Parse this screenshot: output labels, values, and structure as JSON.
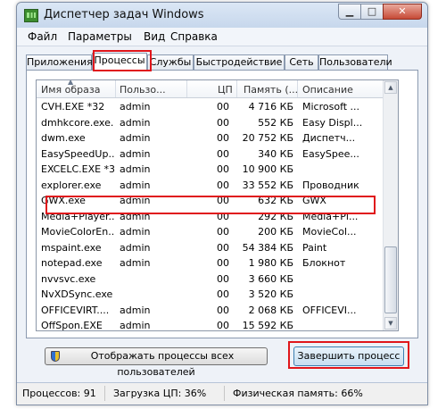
{
  "window": {
    "title": "Диспетчер задач Windows"
  },
  "menu": {
    "file": "Файл",
    "options": "Параметры",
    "view": "Вид",
    "help": "Справка"
  },
  "tabs": [
    "Приложения",
    "Процессы",
    "Службы",
    "Быстродействие",
    "Сеть",
    "Пользователи"
  ],
  "active_tab": "Процессы",
  "columns": [
    "Имя образа",
    "Пользо...",
    "ЦП",
    "Память (...",
    "Описание"
  ],
  "processes": [
    [
      "CVH.EXE *32",
      "admin",
      "00",
      "4 716 КБ",
      "Microsoft ..."
    ],
    [
      "dmhkcore.exe...",
      "admin",
      "00",
      "552 КБ",
      "Easy Displ..."
    ],
    [
      "dwm.exe",
      "admin",
      "00",
      "20 752 КБ",
      "Диспетч..."
    ],
    [
      "EasySpeedUp...",
      "admin",
      "00",
      "340 КБ",
      "EasySpee..."
    ],
    [
      "EXCELC.EXE *32",
      "admin",
      "00",
      "10 900 КБ",
      ""
    ],
    [
      "explorer.exe",
      "admin",
      "00",
      "33 552 КБ",
      "Проводник"
    ],
    [
      "GWX.exe",
      "admin",
      "00",
      "632 КБ",
      "GWX"
    ],
    [
      "Media+Player...",
      "admin",
      "00",
      "292 КБ",
      "Media+Pl..."
    ],
    [
      "MovieColorEn...",
      "admin",
      "00",
      "200 КБ",
      "MovieCol..."
    ],
    [
      "mspaint.exe",
      "admin",
      "00",
      "54 384 КБ",
      "Paint"
    ],
    [
      "notepad.exe",
      "admin",
      "00",
      "1 980 КБ",
      "Блокнот"
    ],
    [
      "nvvsvc.exe",
      "",
      "00",
      "3 660 КБ",
      ""
    ],
    [
      "NvXDSync.exe",
      "",
      "00",
      "3 520 КБ",
      ""
    ],
    [
      "OFFICEVIRT....",
      "admin",
      "00",
      "2 068 КБ",
      "OFFICEVI..."
    ],
    [
      "OffSpon.EXE",
      "admin",
      "00",
      "15 592 КБ",
      ""
    ]
  ],
  "selected_process": "GWX.exe",
  "buttons": {
    "show_all": "Отображать процессы всех пользователей",
    "end_process": "Завершить процесс"
  },
  "status": {
    "processes": "Процессов: 91",
    "cpu": "Загрузка ЦП: 36%",
    "memory": "Физическая память: 66%"
  },
  "colors": {
    "highlight": "#e0161b",
    "window_bg": "#eef2f8"
  },
  "icons": {
    "app": "task-manager-icon",
    "shield": "uac-shield-icon",
    "close": "close-icon"
  }
}
